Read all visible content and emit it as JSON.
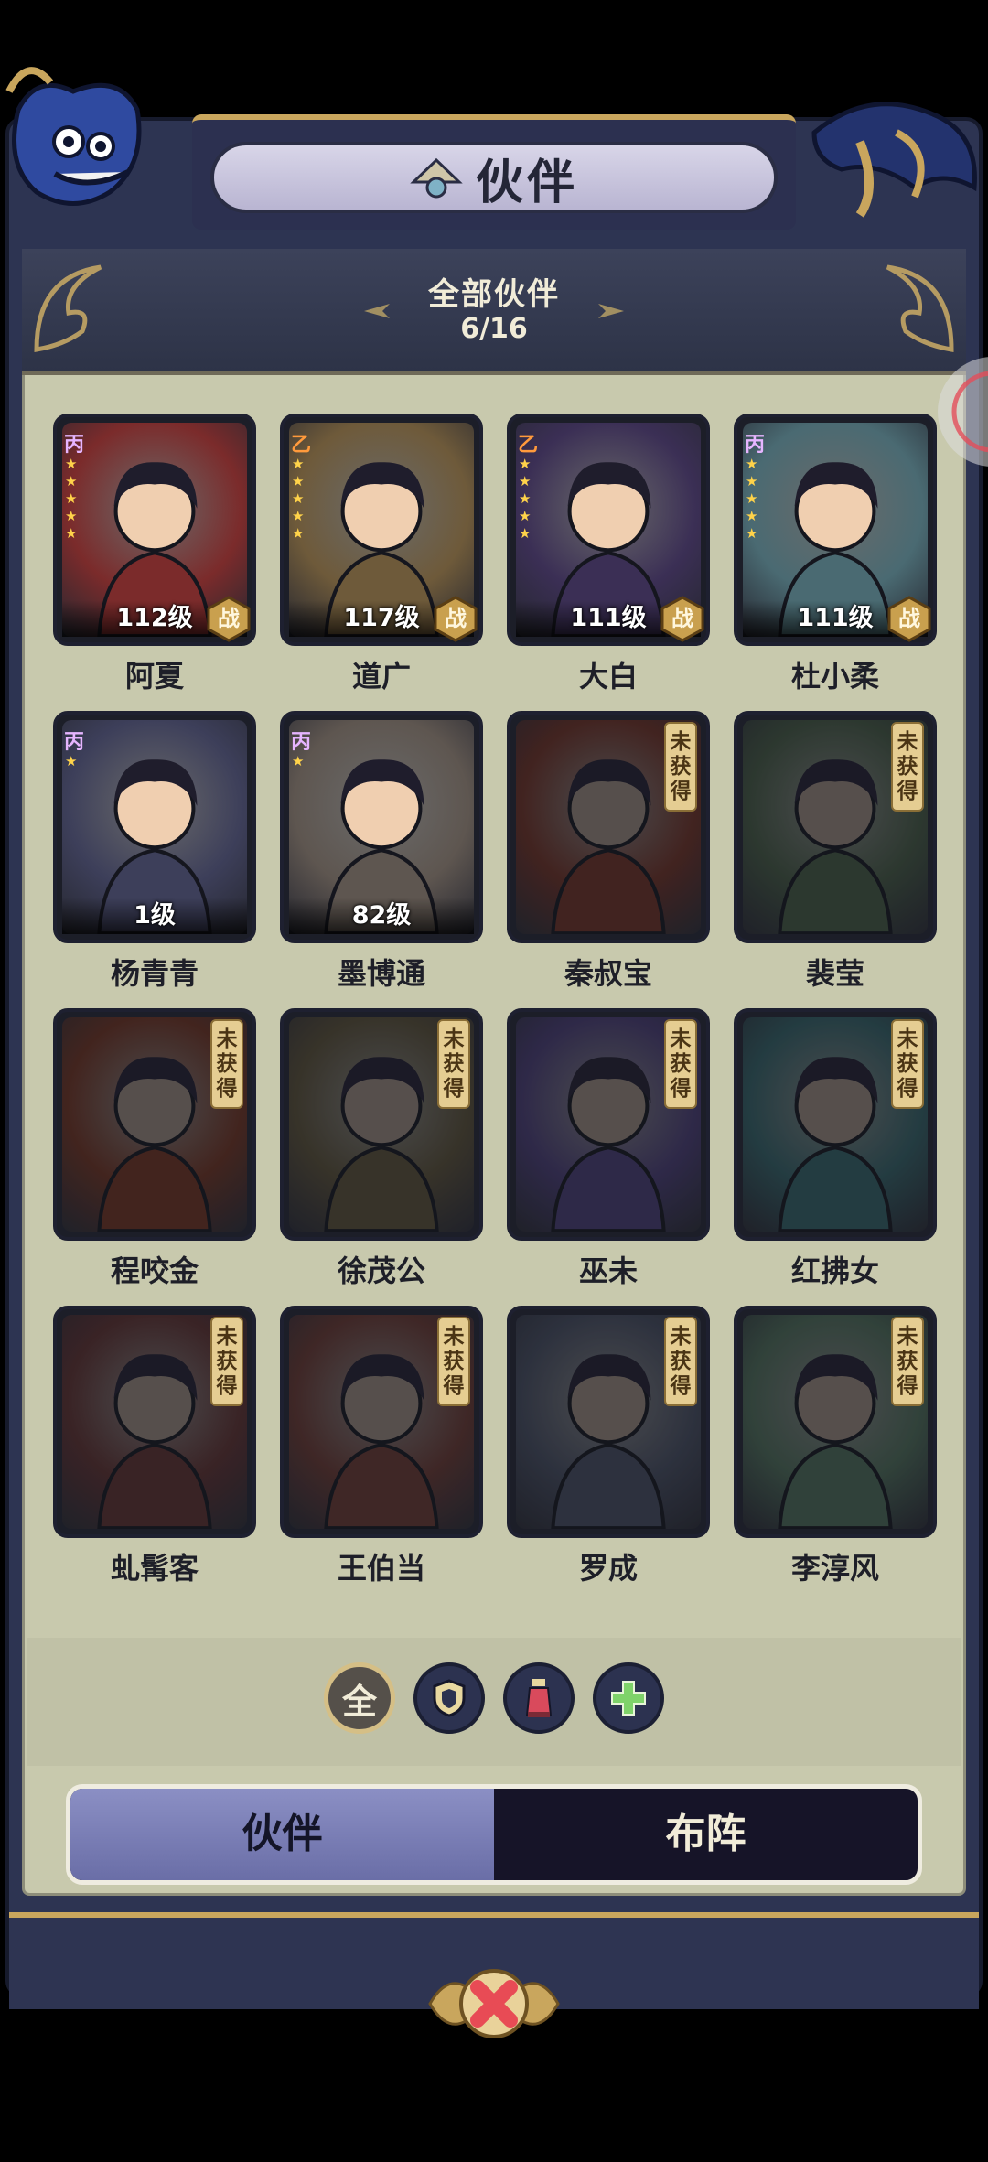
{
  "title": "伙伴",
  "header": {
    "title": "全部伙伴",
    "count": "6/16"
  },
  "partners": [
    {
      "name": "阿夏",
      "grade": "丙",
      "stars": 5,
      "level": "112级",
      "deployed": true,
      "badge": "战",
      "locked": false,
      "hue": "#7b2b2b"
    },
    {
      "name": "道广",
      "grade": "乙",
      "stars": 5,
      "level": "117级",
      "deployed": true,
      "badge": "战",
      "locked": false,
      "hue": "#6e5a3a"
    },
    {
      "name": "大白",
      "grade": "乙",
      "stars": 5,
      "level": "111级",
      "deployed": true,
      "badge": "战",
      "locked": false,
      "hue": "#3b2f55"
    },
    {
      "name": "杜小柔",
      "grade": "丙",
      "stars": 5,
      "level": "111级",
      "deployed": true,
      "badge": "战",
      "locked": false,
      "hue": "#4a6a72"
    },
    {
      "name": "杨青青",
      "grade": "丙",
      "stars": 1,
      "level": "1级",
      "deployed": false,
      "locked": false,
      "hue": "#3d3f5a"
    },
    {
      "name": "墨博通",
      "grade": "丙",
      "stars": 1,
      "level": "82级",
      "deployed": false,
      "locked": false,
      "hue": "#5e5650"
    },
    {
      "name": "秦叔宝",
      "locked": true,
      "lock_label": "未获得",
      "hue": "#5a2a22"
    },
    {
      "name": "裴莹",
      "locked": true,
      "lock_label": "未获得",
      "hue": "#3a4a3a"
    },
    {
      "name": "程咬金",
      "locked": true,
      "lock_label": "未获得",
      "hue": "#5b2c20"
    },
    {
      "name": "徐茂公",
      "locked": true,
      "lock_label": "未获得",
      "hue": "#4a4230"
    },
    {
      "name": "巫未",
      "locked": true,
      "lock_label": "未获得",
      "hue": "#3d3360"
    },
    {
      "name": "红拂女",
      "locked": true,
      "lock_label": "未获得",
      "hue": "#2c5055"
    },
    {
      "name": "虬髯客",
      "locked": true,
      "lock_label": "未获得",
      "hue": "#4e2a2a"
    },
    {
      "name": "王伯当",
      "locked": true,
      "lock_label": "未获得",
      "hue": "#56302c"
    },
    {
      "name": "罗成",
      "locked": true,
      "lock_label": "未获得",
      "hue": "#3b4050"
    },
    {
      "name": "李淳风",
      "locked": true,
      "lock_label": "未获得",
      "hue": "#40584a"
    }
  ],
  "filters": [
    {
      "label": "全",
      "icon": "all-filter",
      "active": true
    },
    {
      "icon": "shield-icon",
      "active": false
    },
    {
      "icon": "potion-icon",
      "active": false
    },
    {
      "icon": "plus-heal-icon",
      "active": false
    }
  ],
  "tabs": {
    "partners": "伙伴",
    "formation": "布阵"
  },
  "colors": {
    "panel": "#c8c9ad",
    "frame": "#2d3452",
    "gold": "#c9a65d",
    "locked_tag": "#e5cd92"
  }
}
